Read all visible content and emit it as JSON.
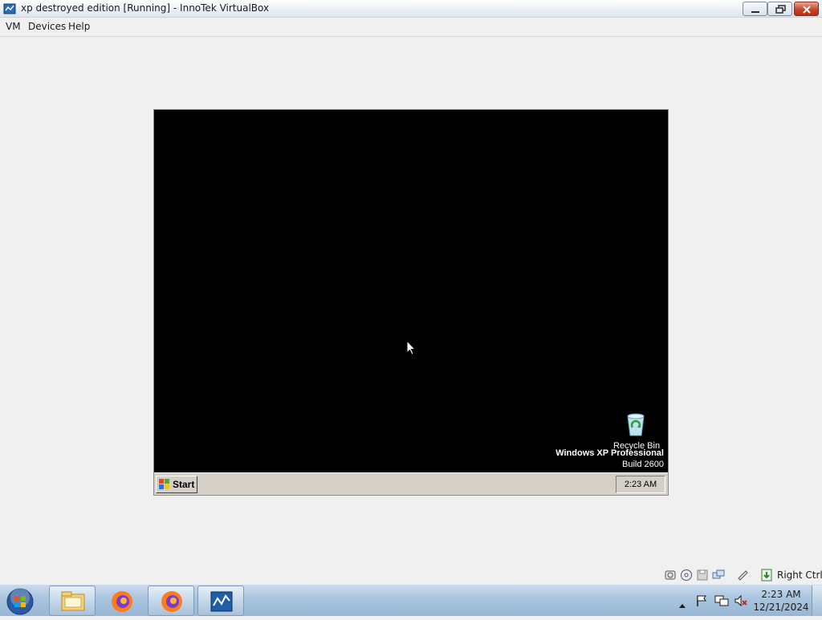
{
  "window": {
    "title": "xp destroyed edition [Running] - InnoTek VirtualBox"
  },
  "menubar": {
    "items": [
      "VM",
      "Devices",
      "Help"
    ]
  },
  "guest": {
    "desktop_icons": [
      {
        "label": "Recycle Bin",
        "icon": "recycle-bin-icon"
      }
    ],
    "watermark": {
      "line1": "Windows XP Professional",
      "line2": "Build 2600"
    },
    "taskbar": {
      "start_label": "Start",
      "clock": "2:23 AM"
    }
  },
  "statusbar": {
    "icons": [
      "hard-disk-icon",
      "cd-icon",
      "floppy-icon",
      "network-icon",
      "usb-icon",
      "mouse-integration-icon"
    ],
    "host_key": "Right Ctrl"
  },
  "host_taskbar": {
    "pinned": [
      "windows-explorer-icon",
      "firefox-icon",
      "firefox-icon",
      "virtualbox-icon"
    ],
    "clock_time": "2:23 AM",
    "clock_date": "12/21/2024",
    "tray_icons": [
      "action-center-flag-icon",
      "network-icon",
      "volume-muted-icon"
    ]
  }
}
